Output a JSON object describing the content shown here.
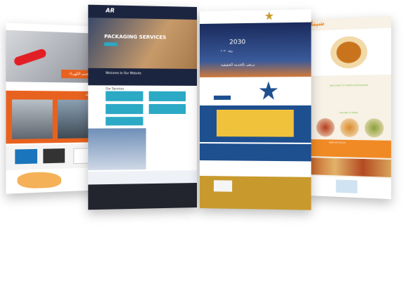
{
  "panel1": {
    "hero_button": "قسم الكهرباء",
    "section_title": "مجالات عملنا",
    "colors": {
      "orange": "#e8621f",
      "gray": "#555555",
      "map": "#f3a33a"
    }
  },
  "panel2": {
    "brand": "AR",
    "hero_title": "PACKAGING SERVICES",
    "welcome": "Welcome to Our Website",
    "services_title": "Our Services",
    "colors": {
      "navy": "#1c2540",
      "teal": "#2ba9c5",
      "dark": "#22252d"
    }
  },
  "panel3": {
    "vision_number": "2030",
    "hero_text": "رؤية ٢٠٣٠",
    "hero_sub": "نرتقي بالخدمة الحقيقية",
    "colors": {
      "blue": "#1e4f8f",
      "gold": "#c89a2e",
      "yellow": "#f0c23c"
    }
  },
  "panel4": {
    "logo_text": "شيتا",
    "welcome": "WELCOME TO SHEETA RESTAURANT",
    "gallery_title": "GALLERY & MENU",
    "contact_title": "KEEP IN TOUCH",
    "colors": {
      "orange": "#f08a24",
      "green": "#7bc043",
      "cream": "#f7f1e6"
    }
  }
}
